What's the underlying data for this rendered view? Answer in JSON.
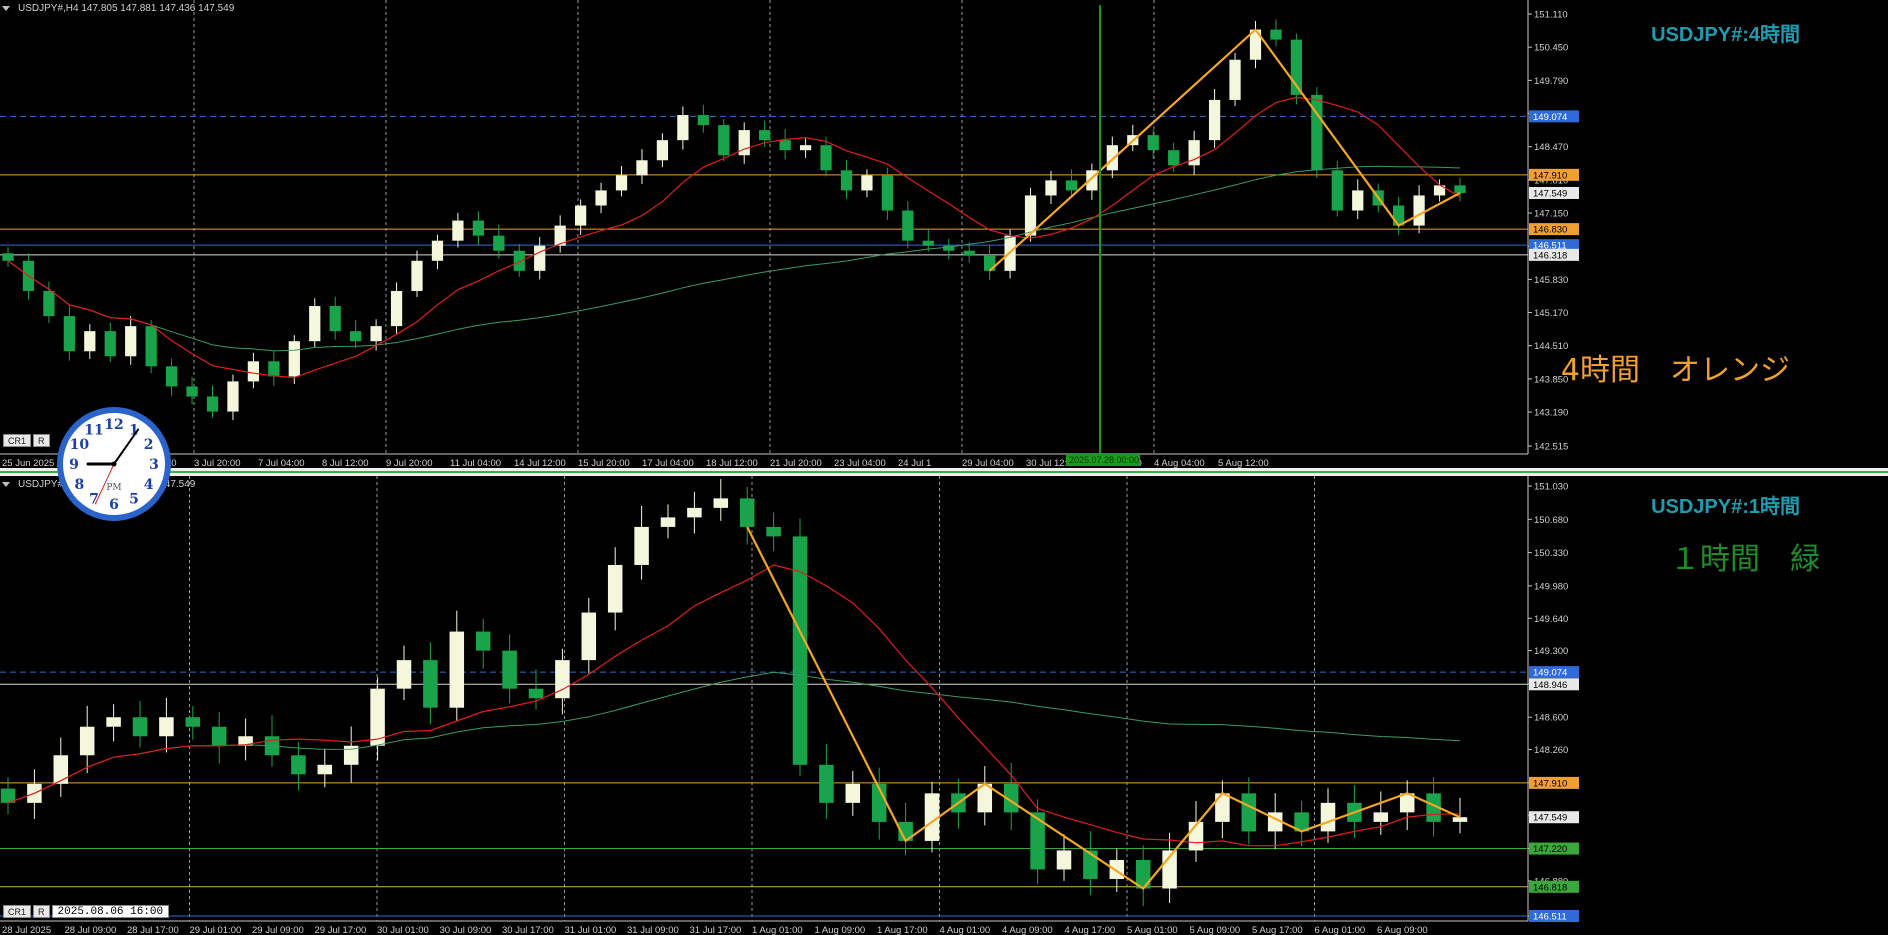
{
  "colors": {
    "bull": "#f5f7dc",
    "bear": "#19a34a",
    "ma_red": "#e21c1c",
    "ma_green": "#3d9a62",
    "zigzag": "#f5a623",
    "orange_line": "#f0a030",
    "blue_dash": "#2f6bd8",
    "green_hline": "#3aa83a",
    "title": "#1f9bb0",
    "note_h4": "#f0a030",
    "note_h1": "#1a8f2a"
  },
  "h4": {
    "ohlc": "USDJPY#,H4  147.805 147.881 147.436 147.549",
    "title": "USDJPY#:4時間",
    "note": "4時間　オレンジ",
    "buttons": [
      "CR1",
      "R"
    ],
    "price_labels": {
      "p1": "149.074",
      "p2": "147.910",
      "p3": "147.549",
      "p4": "146.830",
      "p5": "146.511",
      "p6": "146.318"
    },
    "time_highlight": "2025.07.28 00:00"
  },
  "h1": {
    "ohlc": "USDJPY#,H1  147.805 147.519 147.549",
    "title": "USDJPY#:1時間",
    "note": "１時間　緑",
    "buttons": [
      "CR1",
      "R"
    ],
    "datetime": "2025.08.06 16:00",
    "price_labels": {
      "p1": "149.074",
      "p2": "148.946",
      "p3": "147.910",
      "p4": "147.549",
      "p5": "147.220",
      "p6": "146.818",
      "p7": "146.511"
    }
  },
  "clock": {
    "label": "PM",
    "numbers": [
      "12",
      "1",
      "2",
      "3",
      "4",
      "5",
      "6",
      "7",
      "8",
      "9",
      "10",
      "11"
    ]
  },
  "chart_data": [
    {
      "type": "candlestick",
      "title": "USDJPY#:4時間",
      "timeframe": "H4",
      "ylim": [
        142.515,
        151.11
      ],
      "y_ticks": [
        "151.110",
        "150.450",
        "149.790",
        "149.130",
        "148.470",
        "147.810",
        "147.150",
        "146.490",
        "145.830",
        "145.170",
        "144.510",
        "143.850",
        "143.190",
        "142.515"
      ],
      "x_ticks": [
        "25 Jun 2025",
        "1 Jul 04:00",
        "2 Jul 12:00",
        "3 Jul 20:00",
        "7 Jul 04:00",
        "8 Jul 12:00",
        "9 Jul 20:00",
        "11 Jul 04:00",
        "14 Jul 12:00",
        "15 Jul 20:00",
        "17 Jul 04:00",
        "18 Jul 12:00",
        "21 Jul 20:00",
        "23 Jul 04:00",
        "24 Jul 1",
        "29 Jul 04:00",
        "30 Jul 12:00",
        "31 Jul 20:00",
        "4 Aug 04:00",
        "5 Aug 12:00"
      ],
      "horizontal_lines": [
        149.074,
        147.91,
        146.83,
        146.511,
        146.318
      ],
      "close_series": [
        146.2,
        145.6,
        145.1,
        144.4,
        144.8,
        144.3,
        144.9,
        144.1,
        143.7,
        143.5,
        143.2,
        143.8,
        144.2,
        143.9,
        144.6,
        145.3,
        144.8,
        144.6,
        144.9,
        145.6,
        146.2,
        146.6,
        147.0,
        146.7,
        146.4,
        146.0,
        146.5,
        146.9,
        147.3,
        147.6,
        147.9,
        148.2,
        148.6,
        149.1,
        148.9,
        148.3,
        148.8,
        148.6,
        148.4,
        148.5,
        148.0,
        147.6,
        147.9,
        147.2,
        146.6,
        146.5,
        146.4,
        146.3,
        146.0,
        146.7,
        147.5,
        147.8,
        147.6,
        148.0,
        148.5,
        148.7,
        148.4,
        148.1,
        148.6,
        149.4,
        150.2,
        150.8,
        150.6,
        149.5,
        148.0,
        147.2,
        147.6,
        147.3,
        146.9,
        147.5,
        147.7,
        147.549
      ],
      "series": [
        {
          "name": "",
          "values": []
        }
      ]
    },
    {
      "type": "candlestick",
      "title": "USDJPY#:1時間",
      "timeframe": "H1",
      "ylim": [
        146.511,
        151.03
      ],
      "y_ticks": [
        "151.030",
        "150.680",
        "150.330",
        "149.980",
        "149.640",
        "149.300",
        "148.950",
        "148.600",
        "148.260",
        "147.910",
        "147.570",
        "147.220",
        "146.880",
        "146.511"
      ],
      "x_ticks": [
        "28 Jul 2025",
        "28 Jul 09:00",
        "28 Jul 17:00",
        "29 Jul 01:00",
        "29 Jul 09:00",
        "29 Jul 17:00",
        "30 Jul 01:00",
        "30 Jul 09:00",
        "30 Jul 17:00",
        "31 Jul 01:00",
        "31 Jul 09:00",
        "31 Jul 17:00",
        "1 Aug 01:00",
        "1 Aug 09:00",
        "1 Aug 17:00",
        "4 Aug 01:00",
        "4 Aug 09:00",
        "4 Aug 17:00",
        "5 Aug 01:00",
        "5 Aug 09:00",
        "5 Aug 17:00",
        "6 Aug 01:00",
        "6 Aug 09:00"
      ],
      "horizontal_lines": [
        149.074,
        148.946,
        147.91,
        147.22,
        146.818,
        146.511
      ],
      "close_series": [
        147.7,
        147.9,
        148.2,
        148.5,
        148.6,
        148.4,
        148.6,
        148.5,
        148.3,
        148.4,
        148.2,
        148.0,
        148.1,
        148.3,
        148.9,
        149.2,
        148.7,
        149.5,
        149.3,
        148.9,
        148.8,
        149.2,
        149.7,
        150.2,
        150.6,
        150.7,
        150.8,
        150.9,
        150.6,
        150.5,
        148.1,
        147.7,
        147.9,
        147.5,
        147.3,
        147.8,
        147.6,
        147.9,
        147.6,
        147.0,
        147.2,
        146.9,
        147.1,
        146.8,
        147.2,
        147.5,
        147.8,
        147.4,
        147.6,
        147.4,
        147.7,
        147.5,
        147.6,
        147.8,
        147.5,
        147.549
      ],
      "series": [
        {
          "name": "",
          "values": []
        }
      ]
    }
  ]
}
